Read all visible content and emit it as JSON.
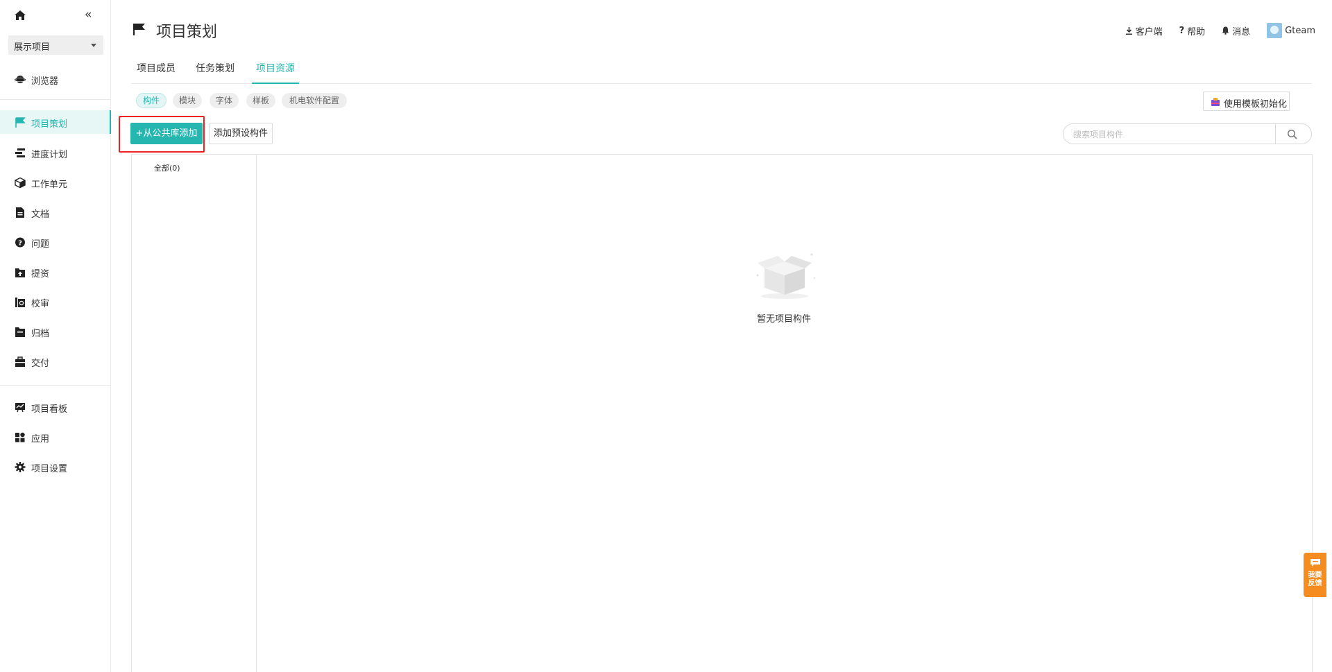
{
  "sidebar": {
    "project_selector": "展示项目",
    "browser_label": "浏览器",
    "items": [
      {
        "label": "项目策划",
        "icon": "flag-icon",
        "active": true
      },
      {
        "label": "进度计划",
        "icon": "gantt-icon"
      },
      {
        "label": "工作单元",
        "icon": "cube-icon"
      },
      {
        "label": "文档",
        "icon": "document-icon"
      },
      {
        "label": "问题",
        "icon": "question-icon"
      },
      {
        "label": "提资",
        "icon": "upload-folder-icon"
      },
      {
        "label": "校审",
        "icon": "review-icon"
      },
      {
        "label": "归档",
        "icon": "archive-icon"
      },
      {
        "label": "交付",
        "icon": "briefcase-icon"
      },
      {
        "label": "项目看板",
        "icon": "dashboard-icon"
      },
      {
        "label": "应用",
        "icon": "apps-icon"
      },
      {
        "label": "项目设置",
        "icon": "gear-icon"
      }
    ]
  },
  "header": {
    "title": "项目策划",
    "client_label": "客户端",
    "help_label": "帮助",
    "messages_label": "消息",
    "user_name": "Gteam"
  },
  "tabs": [
    {
      "label": "项目成员"
    },
    {
      "label": "任务策划"
    },
    {
      "label": "项目资源",
      "active": true
    }
  ],
  "categories": [
    {
      "label": "构件",
      "active": true
    },
    {
      "label": "模块"
    },
    {
      "label": "字体"
    },
    {
      "label": "样板"
    },
    {
      "label": "机电软件配置"
    }
  ],
  "toolbar": {
    "template_init_label": "使用模板初始化",
    "add_from_library_label": "+从公共库添加",
    "add_preset_label": "添加预设构件",
    "search_placeholder": "搜索项目构件"
  },
  "category_tree": {
    "all_label": "全部(0)"
  },
  "empty_state": {
    "text": "暂无项目构件"
  },
  "feedback": {
    "label": "我要反馈"
  },
  "colors": {
    "accent": "#26b6b0",
    "highlight_border": "#ee2222",
    "feedback_orange": "#f58c1f"
  }
}
